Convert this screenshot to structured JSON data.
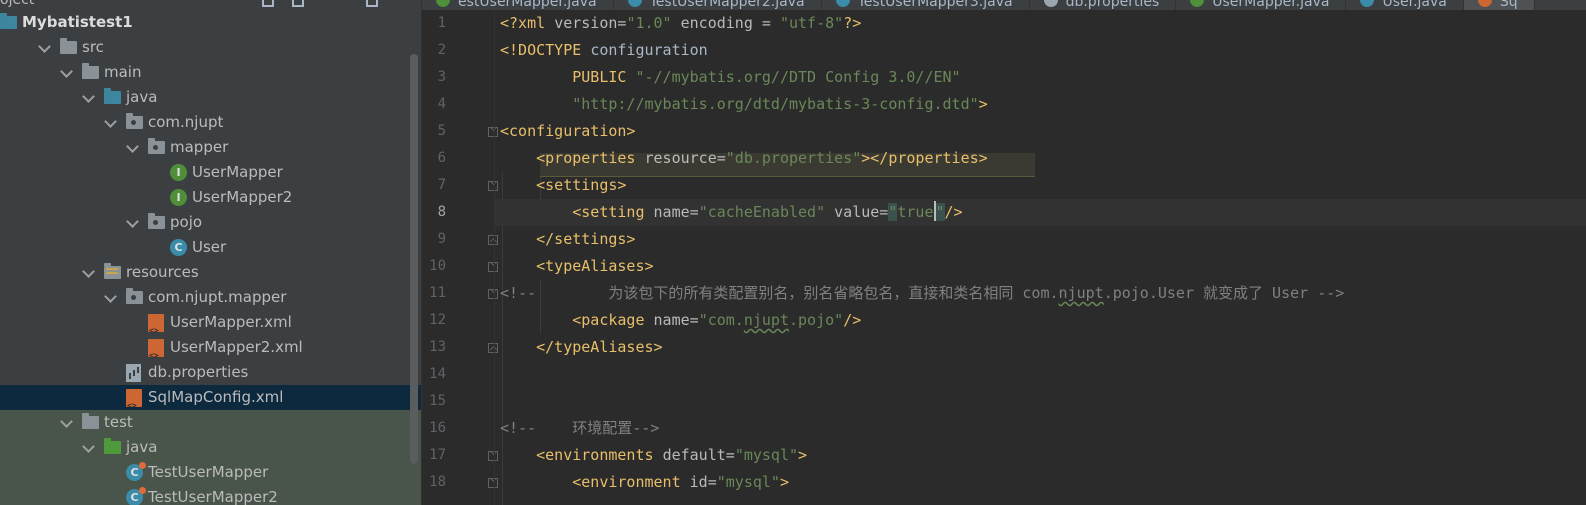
{
  "topbar": {
    "project_label": "oject"
  },
  "tabs": [
    {
      "label": "estUserMapper.java",
      "color": "#4e8f3a"
    },
    {
      "label": "TestUserMapper2.java",
      "color": "#3a8ca9"
    },
    {
      "label": "TestUserMapper3.java",
      "color": "#3a8ca9"
    },
    {
      "label": "db.properties",
      "color": "#9aa7b0"
    },
    {
      "label": "UserMapper.java",
      "color": "#4f8f3a"
    },
    {
      "label": "User.java",
      "color": "#3a8ca9"
    },
    {
      "label": "Sq",
      "color": "#cc6633",
      "active": true
    }
  ],
  "project_tree": [
    {
      "label": "Mybatistest1",
      "icon": "module",
      "bold": true
    },
    {
      "label": "src",
      "icon": "folder",
      "expanded": true
    },
    {
      "label": "main",
      "icon": "folder",
      "expanded": true
    },
    {
      "label": "java",
      "icon": "source-folder",
      "expanded": true
    },
    {
      "label": "com.njupt",
      "icon": "package",
      "expanded": true
    },
    {
      "label": "mapper",
      "icon": "package",
      "expanded": true
    },
    {
      "label": "UserMapper",
      "icon": "interface"
    },
    {
      "label": "UserMapper2",
      "icon": "interface"
    },
    {
      "label": "pojo",
      "icon": "package",
      "expanded": true
    },
    {
      "label": "User",
      "icon": "class"
    },
    {
      "label": "resources",
      "icon": "resources-folder",
      "expanded": true
    },
    {
      "label": "com.njupt.mapper",
      "icon": "package",
      "expanded": true
    },
    {
      "label": "UserMapper.xml",
      "icon": "xml"
    },
    {
      "label": "UserMapper2.xml",
      "icon": "xml"
    },
    {
      "label": "db.properties",
      "icon": "properties"
    },
    {
      "label": "SqlMapConfig.xml",
      "icon": "xml",
      "selected": true
    },
    {
      "label": "test",
      "icon": "folder",
      "expanded": true
    },
    {
      "label": "java",
      "icon": "test-folder",
      "expanded": true
    },
    {
      "label": "TestUserMapper",
      "icon": "test-class"
    },
    {
      "label": "TestUserMapper2",
      "icon": "test-class"
    }
  ],
  "editor": {
    "current_line": 8,
    "lines": [
      {
        "num": "1"
      },
      {
        "num": "2"
      },
      {
        "num": "3"
      },
      {
        "num": "4"
      },
      {
        "num": "5"
      },
      {
        "num": "6"
      },
      {
        "num": "7"
      },
      {
        "num": "8"
      },
      {
        "num": "9"
      },
      {
        "num": "10"
      },
      {
        "num": "11"
      },
      {
        "num": "12"
      },
      {
        "num": "13"
      },
      {
        "num": "14"
      },
      {
        "num": "15"
      },
      {
        "num": "16"
      },
      {
        "num": "17"
      },
      {
        "num": "18"
      }
    ],
    "code": {
      "l1_pi_open": "<?xml ",
      "l1_attr1": "version=",
      "l1_val1": "\"1.0\"",
      "l1_attr2": " encoding = ",
      "l1_val2": "\"utf-8\"",
      "l1_pi_close": "?>",
      "l2_doctype": "<!DOCTYPE ",
      "l2_name": "configuration",
      "l3_public": "PUBLIC ",
      "l3_val": "\"-//mybatis.org//DTD Config 3.0//EN\"",
      "l4_val": "\"http://mybatis.org/dtd/mybatis-3-config.dtd\"",
      "l4_close": ">",
      "l5_tag": "<configuration>",
      "l6_open": "<properties ",
      "l6_attr": "resource=",
      "l6_val": "\"db.properties\"",
      "l6_close": "></properties>",
      "l7_tag": "<settings>",
      "l8_open": "<setting ",
      "l8_attr1": "name=",
      "l8_val1": "\"cacheEnabled\"",
      "l8_attr2": " value=",
      "l8_q1": "\"",
      "l8_val2": "true",
      "l8_q2": "\"",
      "l8_close": "/>",
      "l9_tag": "</settings>",
      "l10_tag": "<typeAliases>",
      "l11_open": "<!--",
      "l11_text": "        为该包下的所有类配置别名，别名省略包名，直接和类名相同 com.",
      "l11_njupt": "njupt",
      "l11_rest": ".pojo.User 就变成了 User -->",
      "l12_open": "<package ",
      "l12_attr": "name=",
      "l12_val_a": "\"com.",
      "l12_val_b": "njupt",
      "l12_val_c": ".pojo\"",
      "l12_close": "/>",
      "l13_tag": "</typeAliases>",
      "l16_comment": "<!--    环境配置-->",
      "l17_open": "<environments ",
      "l17_attr": "default=",
      "l17_val": "\"mysql\"",
      "l17_close": ">",
      "l18_open": "<environment ",
      "l18_attr": "id=",
      "l18_val": "\"mysql\"",
      "l18_close": ">"
    }
  }
}
